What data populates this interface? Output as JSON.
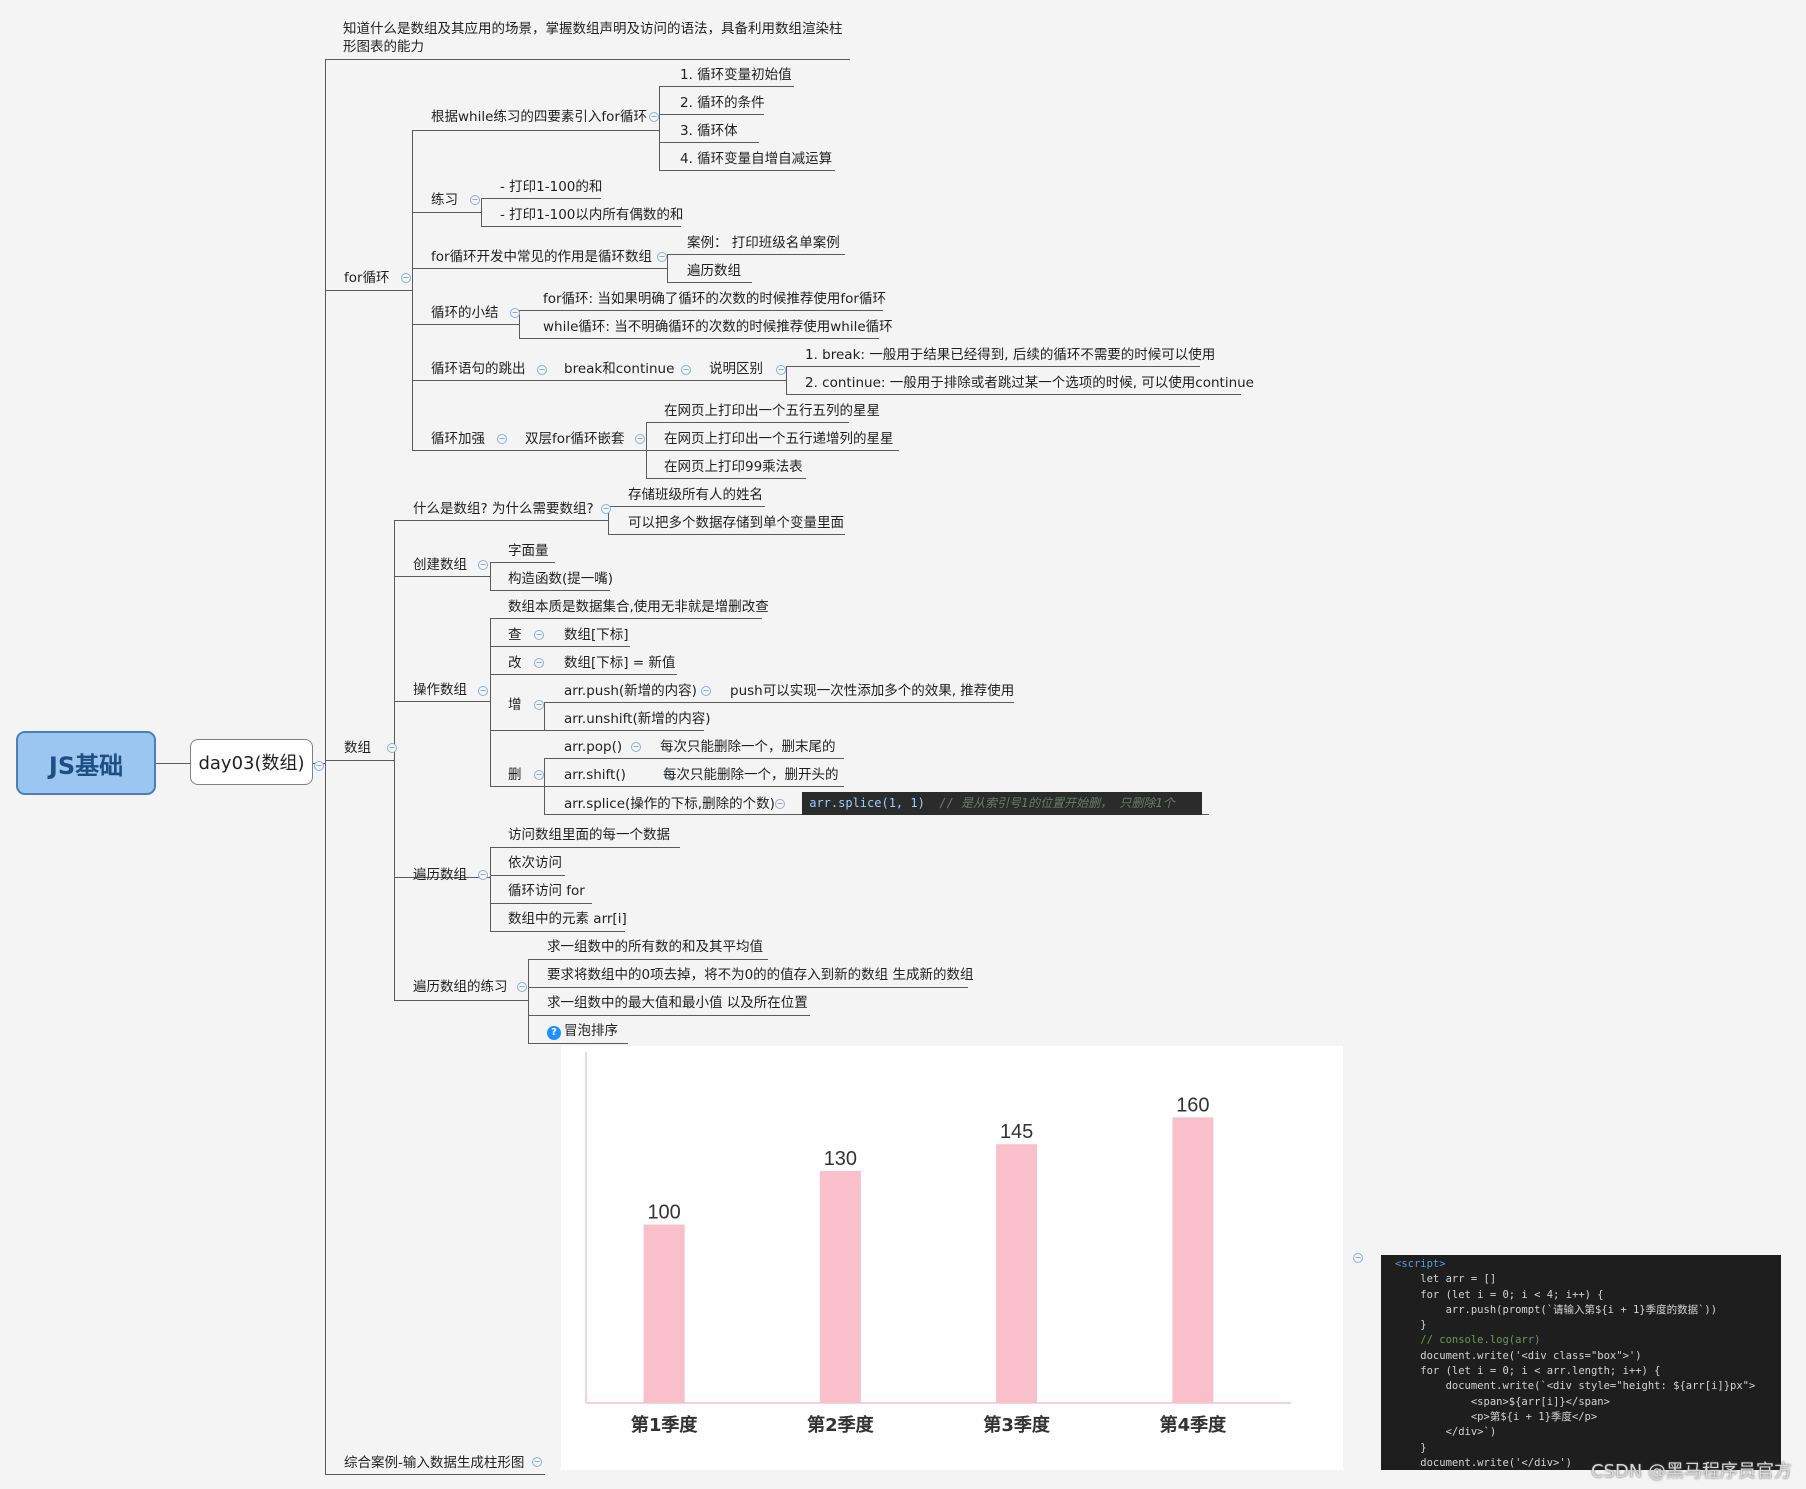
{
  "root": "JS基础",
  "day": "day03(数组)",
  "goal": "知道什么是数组及其应用的场景，掌握数组声明及访问的语法，具备利用数组渲染柱形图表的能力",
  "for_loop": {
    "title": "for循环",
    "intro": {
      "label": "根据while练习的四要素引入for循环",
      "items": [
        "1. 循环变量初始值",
        "2. 循环的条件",
        "3. 循环体",
        "4. 循环变量自增自减运算"
      ]
    },
    "practice": {
      "label": "练习",
      "items": [
        "- 打印1-100的和",
        "- 打印1-100以内所有偶数的和"
      ]
    },
    "traverse": {
      "label": "for循环开发中常见的作用是循环数组",
      "items": [
        "案例： 打印班级名单案例",
        "遍历数组"
      ]
    },
    "summary": {
      "label": "循环的小结",
      "items": [
        "for循环: 当如果明确了循环的次数的时候推荐使用for循环",
        "while循环: 当不明确循环的次数的时候推荐使用while循环"
      ]
    },
    "jump": {
      "label": "循环语句的跳出",
      "sub": "break和continue",
      "explain": "说明区别",
      "items": [
        "1. break: 一般用于结果已经得到, 后续的循环不需要的时候可以使用",
        "2. continue: 一般用于排除或者跳过某一个选项的时候, 可以使用continue"
      ]
    },
    "enhance": {
      "label": "循环加强",
      "sub": "双层for循环嵌套",
      "items": [
        "在网页上打印出一个五行五列的星星",
        "在网页上打印出一个五行递增列的星星",
        "在网页上打印99乘法表"
      ]
    }
  },
  "array": {
    "title": "数组",
    "what": {
      "label": "什么是数组? 为什么需要数组?",
      "items": [
        "存储班级所有人的姓名",
        "可以把多个数据存储到单个变量里面"
      ]
    },
    "create": {
      "label": "创建数组",
      "items": [
        "字面量",
        "构造函数(提一嘴)"
      ]
    },
    "operate": {
      "label": "操作数组",
      "essence": "数组本质是数据集合,使用无非就是增删改查",
      "query": {
        "label": "查",
        "item": "数组[下标]"
      },
      "modify": {
        "label": "改",
        "item": "数组[下标] = 新值"
      },
      "add": {
        "label": "增",
        "push": "arr.push(新增的内容)",
        "push_note": "push可以实现一次性添加多个的效果, 推荐使用",
        "unshift": "arr.unshift(新增的内容)"
      },
      "remove": {
        "label": "删",
        "pop": "arr.pop()",
        "pop_note": "每次只能删除一个，删末尾的",
        "shift": "arr.shift()",
        "shift_note": "每次只能删除一个，删开头的",
        "splice": "arr.splice(操作的下标,删除的个数)",
        "splice_code": "arr.splice(1, 1)",
        "splice_comment": "// 是从索引号1的位置开始删， 只删除1个"
      }
    },
    "traverse": {
      "label": "遍历数组",
      "items": [
        "访问数组里面的每一个数据",
        "依次访问",
        "循环访问 for",
        "数组中的元素  arr[i]"
      ]
    },
    "exercise": {
      "label": "遍历数组的练习",
      "items": [
        "求一组数中的所有数的和及其平均值",
        "要求将数组中的0项去掉，将不为0的的值存入到新的数组 生成新的数组",
        "求一组数中的最大值和最小值 以及所在位置",
        "冒泡排序"
      ],
      "help_icon": "question-icon"
    }
  },
  "case_study": "综合案例-输入数据生成柱形图",
  "chart_data": {
    "type": "bar",
    "categories": [
      "第1季度",
      "第2季度",
      "第3季度",
      "第4季度"
    ],
    "values": [
      100,
      130,
      145,
      160
    ],
    "ylim": [
      0,
      200
    ],
    "bar_color": "#f9bfcb",
    "axis_color": "#f2c4cc"
  },
  "code_lines": [
    "<script>",
    "    let arr = []",
    "    for (let i = 0; i < 4; i++) {",
    "        arr.push(prompt(`请输入第${i + 1}季度的数据`))",
    "    }",
    "    // console.log(arr)",
    "    document.write('<div class=\"box\">')",
    "    for (let i = 0; i < arr.length; i++) {",
    "        document.write(`<div style=\"height: ${arr[i]}px\">",
    "            <span>${arr[i]}</span>",
    "            <p>第${i + 1}季度</p>",
    "        </div>`)",
    "    }",
    "    document.write('</div>')"
  ],
  "watermark": "CSDN @黑马程序员官方"
}
